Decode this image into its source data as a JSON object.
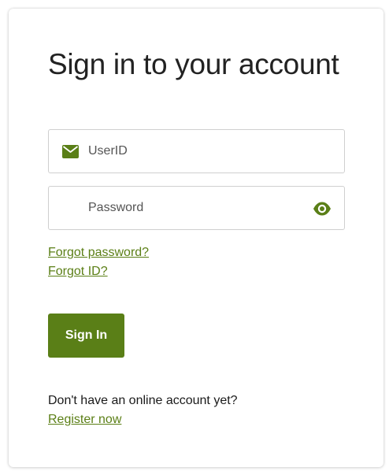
{
  "title": "Sign in to your account",
  "userid_field": {
    "placeholder": "UserID",
    "value": "",
    "icon": "mail-icon"
  },
  "password_field": {
    "placeholder": "Password",
    "value": "",
    "icon": "eye-icon"
  },
  "links": {
    "forgot_password": "Forgot password?",
    "forgot_id": "Forgot ID?"
  },
  "signin_button": "Sign In",
  "register": {
    "prompt": "Don't have an online account yet?",
    "link": "Register now"
  },
  "colors": {
    "accent": "#5a7f17",
    "link": "#5b7f16",
    "title": "#222222"
  }
}
